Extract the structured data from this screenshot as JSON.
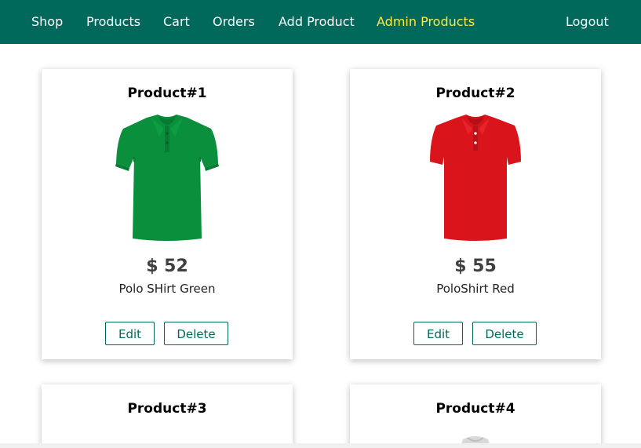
{
  "nav": {
    "items": [
      {
        "label": "Shop"
      },
      {
        "label": "Products"
      },
      {
        "label": "Cart"
      },
      {
        "label": "Orders"
      },
      {
        "label": "Add Product"
      },
      {
        "label": "Admin Products",
        "active": true
      }
    ],
    "logout_label": "Logout"
  },
  "products": [
    {
      "title": "Product#1",
      "price": "$ 52",
      "description": "Polo SHirt Green",
      "color": "#0a8f3c",
      "edit_label": "Edit",
      "delete_label": "Delete"
    },
    {
      "title": "Product#2",
      "price": "$ 55",
      "description": "PoloShirt Red",
      "color": "#d9141b",
      "edit_label": "Edit",
      "delete_label": "Delete"
    },
    {
      "title": "Product#3"
    },
    {
      "title": "Product#4"
    }
  ],
  "colors": {
    "nav_bg": "#00695c",
    "nav_active": "#ffeb3b",
    "button_border": "#00695c"
  }
}
